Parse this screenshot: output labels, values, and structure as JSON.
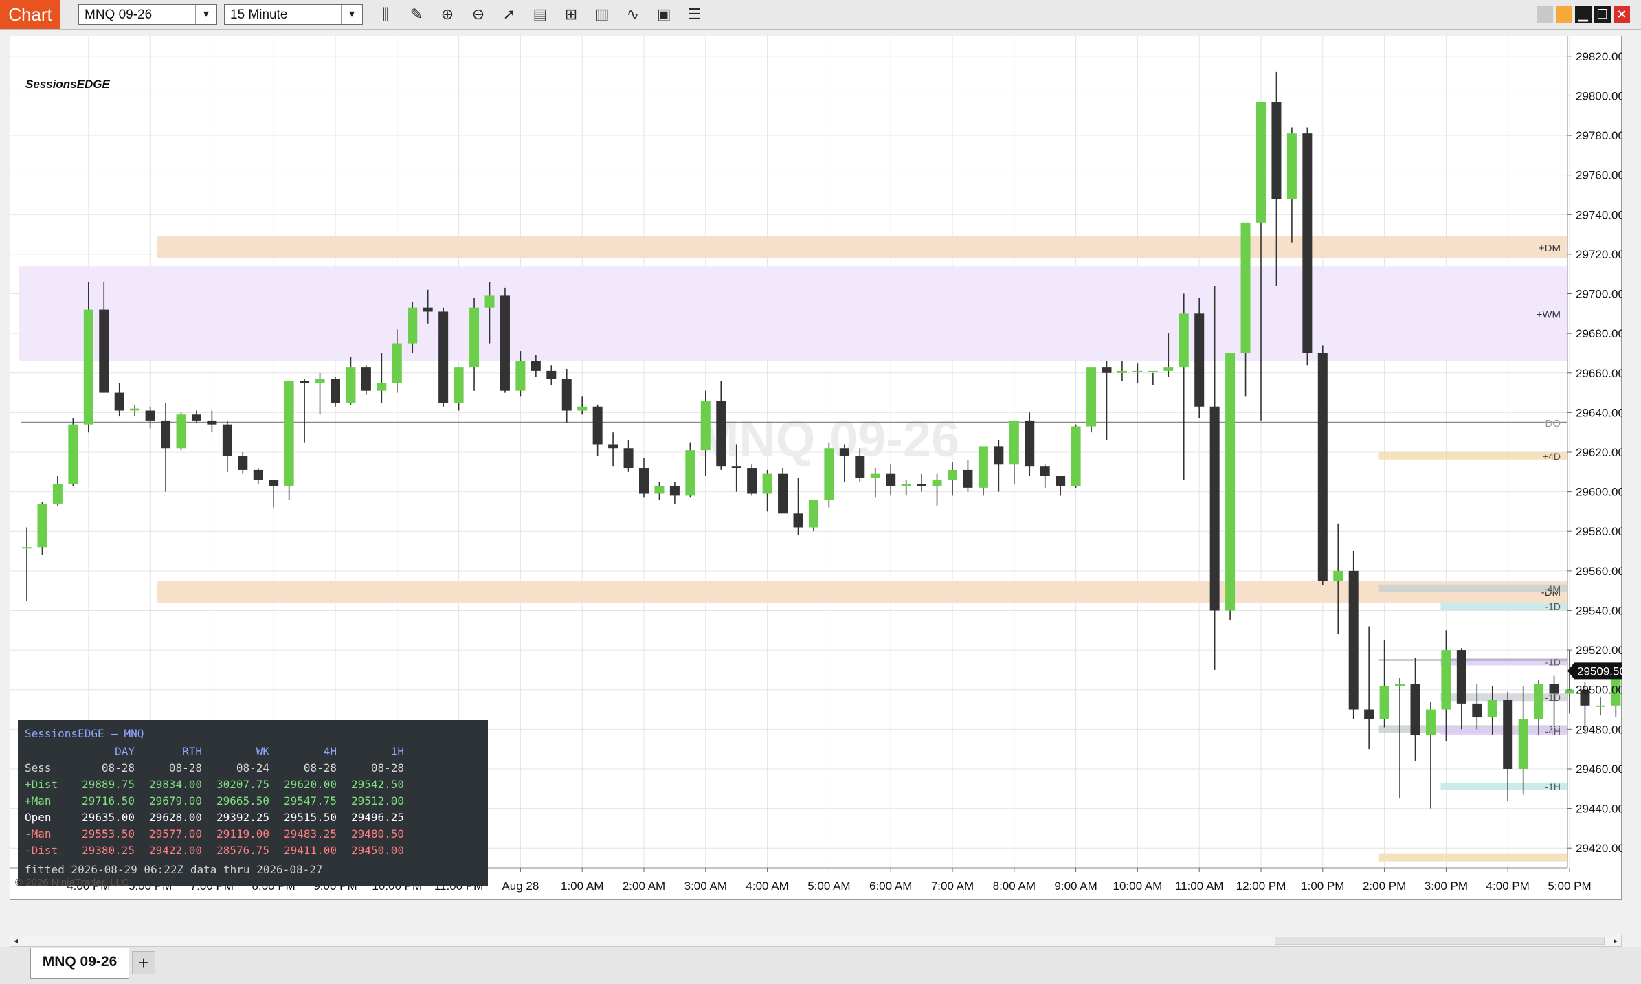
{
  "app": {
    "tab_label": "Chart",
    "instrument": "MNQ 09-26",
    "interval": "15 Minute",
    "document_tab": "MNQ 09-26",
    "add_tab_label": "+",
    "indicator_label": "SessionsEDGE",
    "watermark": "MNQ 09-26",
    "copyright": "© 2026 NinjaTrader, LLC",
    "price_marker": "29509.50"
  },
  "toolbar": {
    "tools": [
      {
        "icon": "bar-type-icon",
        "glyph": "⫼"
      },
      {
        "icon": "drawing-tool-icon",
        "glyph": "✎"
      },
      {
        "icon": "zoom-in-icon",
        "glyph": "⊕"
      },
      {
        "icon": "zoom-out-icon",
        "glyph": "⊖"
      },
      {
        "icon": "pointer-icon",
        "glyph": "➚"
      },
      {
        "icon": "data-box-icon",
        "glyph": "▤"
      },
      {
        "icon": "properties-icon",
        "glyph": "⊞"
      },
      {
        "icon": "chart-trader-icon",
        "glyph": "▥"
      },
      {
        "icon": "indicators-icon",
        "glyph": "∿"
      },
      {
        "icon": "strategies-icon",
        "glyph": "▣"
      },
      {
        "icon": "templates-icon",
        "glyph": "☰"
      }
    ],
    "window_buttons": [
      {
        "icon": "window-grey-icon",
        "color": "#c8c8c8"
      },
      {
        "icon": "window-orange-icon",
        "color": "#f4a93a"
      },
      {
        "icon": "minimize-icon",
        "color": "#1a1a1a"
      },
      {
        "icon": "maximize-icon",
        "color": "#1a1a1a"
      },
      {
        "icon": "close-icon",
        "color": "#d9302c"
      }
    ]
  },
  "colors": {
    "up_candle": "#6ccf4c",
    "down_candle": "#333333",
    "dm_zone": "#f6ddc4",
    "wm_zone": "#efe6fb",
    "day_open_line": "#888888",
    "table_bg": "#2e3338",
    "table_header": "#8fa8ff",
    "table_positive": "#7fe07f",
    "table_negative": "#ff7f7f",
    "table_open": "#ffffff"
  },
  "chart_data": {
    "type": "candlestick",
    "ylim": [
      29410,
      29830
    ],
    "y_ticks": [
      29420,
      29440,
      29460,
      29480,
      29500,
      29520,
      29540,
      29560,
      29580,
      29600,
      29620,
      29640,
      29660,
      29680,
      29700,
      29720,
      29740,
      29760,
      29780,
      29800,
      29820
    ],
    "y_tick_labels": [
      "29420.00",
      "29440.00",
      "29460.00",
      "29480.00",
      "29500.00",
      "29520.00",
      "29540.00",
      "29560.00",
      "29580.00",
      "29600.00",
      "29620.00",
      "29640.00",
      "29660.00",
      "29680.00",
      "29700.00",
      "29720.00",
      "29740.00",
      "29760.00",
      "29780.00",
      "29800.00",
      "29820.00"
    ],
    "x_labels": [
      "4:00 PM",
      "5:00 PM",
      "7:00 PM",
      "8:00 PM",
      "9:00 PM",
      "10:00 PM",
      "11:00 PM",
      "Aug 28",
      "1:00 AM",
      "2:00 AM",
      "3:00 AM",
      "4:00 AM",
      "5:00 AM",
      "6:00 AM",
      "7:00 AM",
      "8:00 AM",
      "9:00 AM",
      "10:00 AM",
      "11:00 AM",
      "12:00 PM",
      "1:00 PM",
      "2:00 PM",
      "3:00 PM",
      "4:00 PM",
      "5:00 PM"
    ],
    "x_label_bar_index": [
      4,
      8,
      12,
      16,
      20,
      24,
      28,
      32,
      36,
      40,
      44,
      48,
      52,
      56,
      60,
      64,
      68,
      72,
      76,
      80,
      84,
      88,
      92,
      96,
      100
    ],
    "candles": [
      [
        29572,
        29582,
        29545,
        29572
      ],
      [
        29572,
        29595,
        29568,
        29594
      ],
      [
        29594,
        29608,
        29593,
        29604
      ],
      [
        29604,
        29637,
        29603,
        29634
      ],
      [
        29634,
        29706,
        29630,
        29692
      ],
      [
        29692,
        29706,
        29650,
        29650
      ],
      [
        29650,
        29655,
        29638,
        29641
      ],
      [
        29641,
        29644,
        29638,
        29642
      ],
      [
        29641,
        29643,
        29632,
        29636
      ],
      [
        29636,
        29645,
        29600,
        29622
      ],
      [
        29622,
        29640,
        29621,
        29639
      ],
      [
        29639,
        29641,
        29635,
        29636
      ],
      [
        29636,
        29641,
        29630,
        29634
      ],
      [
        29634,
        29636,
        29610,
        29618
      ],
      [
        29618,
        29620,
        29609,
        29611
      ],
      [
        29611,
        29612,
        29604,
        29606
      ],
      [
        29606,
        29606,
        29592,
        29603
      ],
      [
        29603,
        29656,
        29596,
        29656
      ],
      [
        29656,
        29657,
        29625,
        29655
      ],
      [
        29655,
        29660,
        29639,
        29657
      ],
      [
        29657,
        29658,
        29643,
        29645
      ],
      [
        29645,
        29668,
        29644,
        29663
      ],
      [
        29663,
        29664,
        29649,
        29651
      ],
      [
        29651,
        29670,
        29645,
        29655
      ],
      [
        29655,
        29682,
        29650,
        29675
      ],
      [
        29675,
        29696,
        29670,
        29693
      ],
      [
        29693,
        29702,
        29685,
        29691
      ],
      [
        29691,
        29693,
        29643,
        29645
      ],
      [
        29645,
        29663,
        29641,
        29663
      ],
      [
        29663,
        29698,
        29651,
        29693
      ],
      [
        29693,
        29706,
        29675,
        29699
      ],
      [
        29699,
        29703,
        29650,
        29651
      ],
      [
        29651,
        29671,
        29648,
        29666
      ],
      [
        29666,
        29669,
        29658,
        29661
      ],
      [
        29661,
        29664,
        29654,
        29657
      ],
      [
        29657,
        29662,
        29635,
        29641
      ],
      [
        29641,
        29648,
        29639,
        29643
      ],
      [
        29643,
        29644,
        29618,
        29624
      ],
      [
        29624,
        29630,
        29613,
        29622
      ],
      [
        29622,
        29626,
        29610,
        29612
      ],
      [
        29612,
        29617,
        29597,
        29599
      ],
      [
        29599,
        29605,
        29596,
        29603
      ],
      [
        29603,
        29605,
        29594,
        29598
      ],
      [
        29598,
        29625,
        29597,
        29621
      ],
      [
        29621,
        29651,
        29608,
        29646
      ],
      [
        29646,
        29656,
        29611,
        29613
      ],
      [
        29613,
        29624,
        29600,
        29612
      ],
      [
        29612,
        29614,
        29598,
        29599
      ],
      [
        29599,
        29611,
        29590,
        29609
      ],
      [
        29609,
        29612,
        29590,
        29589
      ],
      [
        29589,
        29607,
        29578,
        29582
      ],
      [
        29582,
        29596,
        29580,
        29596
      ],
      [
        29596,
        29625,
        29592,
        29622
      ],
      [
        29622,
        29624,
        29605,
        29618
      ],
      [
        29618,
        29622,
        29605,
        29607
      ],
      [
        29607,
        29612,
        29597,
        29609
      ],
      [
        29609,
        29614,
        29598,
        29603
      ],
      [
        29603,
        29606,
        29598,
        29604
      ],
      [
        29604,
        29609,
        29600,
        29603
      ],
      [
        29603,
        29609,
        29593,
        29606
      ],
      [
        29606,
        29615,
        29598,
        29611
      ],
      [
        29611,
        29616,
        29600,
        29602
      ],
      [
        29602,
        29620,
        29598,
        29623
      ],
      [
        29623,
        29626,
        29600,
        29614
      ],
      [
        29614,
        29636,
        29604,
        29636
      ],
      [
        29636,
        29640,
        29608,
        29613
      ],
      [
        29613,
        29614,
        29602,
        29608
      ],
      [
        29608,
        29608,
        29598,
        29603
      ],
      [
        29603,
        29634,
        29602,
        29633
      ],
      [
        29633,
        29663,
        29630,
        29663
      ],
      [
        29663,
        29666,
        29626,
        29660
      ],
      [
        29660,
        29666,
        29656,
        29661
      ],
      [
        29661,
        29665,
        29655,
        29661
      ],
      [
        29661,
        29660,
        29654,
        29661
      ],
      [
        29661,
        29680,
        29658,
        29663
      ],
      [
        29663,
        29700,
        29606,
        29690
      ],
      [
        29690,
        29698,
        29637,
        29643
      ],
      [
        29643,
        29704,
        29510,
        29540
      ],
      [
        29540,
        29664,
        29535,
        29670
      ],
      [
        29670,
        29722,
        29648,
        29736
      ],
      [
        29736,
        29792,
        29636,
        29797
      ],
      [
        29797,
        29812,
        29704,
        29748
      ],
      [
        29748,
        29784,
        29726,
        29781
      ],
      [
        29781,
        29784,
        29664,
        29670
      ],
      [
        29670,
        29674,
        29553,
        29555
      ],
      [
        29555,
        29584,
        29528,
        29560
      ],
      [
        29560,
        29570,
        29485,
        29490
      ],
      [
        29490,
        29532,
        29470,
        29485
      ],
      [
        29485,
        29525,
        29481,
        29502
      ],
      [
        29502,
        29506,
        29445,
        29503
      ],
      [
        29503,
        29516,
        29464,
        29477
      ],
      [
        29477,
        29494,
        29440,
        29490
      ],
      [
        29490,
        29530,
        29474,
        29520
      ],
      [
        29520,
        29521,
        29480,
        29493
      ],
      [
        29493,
        29503,
        29480,
        29486
      ],
      [
        29486,
        29502,
        29477,
        29495
      ],
      [
        29495,
        29499,
        29444,
        29460
      ],
      [
        29460,
        29502,
        29447,
        29485
      ],
      [
        29485,
        29505,
        29477,
        29503
      ],
      [
        29503,
        29507,
        29482,
        29498
      ],
      [
        29498,
        29520,
        29488,
        29500
      ],
      [
        29500,
        29504,
        29478,
        29492
      ],
      [
        29492,
        29496,
        29487,
        29492
      ],
      [
        29492,
        29512,
        29486,
        29508
      ],
      [
        29508,
        29510,
        29496,
        29509.5
      ]
    ],
    "zones": [
      {
        "label": "+DM",
        "from": 29718,
        "to": 29729,
        "start_bar": 9,
        "color": "#f6ddc4"
      },
      {
        "label": "+WM",
        "from": 29666,
        "to": 29714,
        "start_bar": 0,
        "color": "#efe6fb"
      },
      {
        "label": "-DM",
        "from": 29544,
        "to": 29555,
        "start_bar": 9,
        "color": "#f6ddc4"
      }
    ],
    "lines": [
      {
        "label": "DO",
        "value": 29635,
        "start_bar": 0,
        "color": "#8a8a8a"
      },
      {
        "label": "",
        "value": 29515,
        "start_bar": 88,
        "color": "#9a9a9a"
      }
    ],
    "right_markers": [
      {
        "label": "+4D",
        "value": 29618,
        "start_bar": 88,
        "color": "#f2ddb3"
      },
      {
        "label": "-4M",
        "value": 29551,
        "start_bar": 88,
        "color": "#cad1d0"
      },
      {
        "label": "-1D",
        "value": 29542,
        "start_bar": 92,
        "color": "#bfe7e7"
      },
      {
        "label": "-1D",
        "value": 29514,
        "start_bar": 92,
        "color": "#dccbf5"
      },
      {
        "label": "-1D",
        "value": 29496,
        "start_bar": 92,
        "color": "#cfd2d8"
      },
      {
        "label": "-1H",
        "value": 29480,
        "start_bar": 88,
        "color": "#cad1d0"
      },
      {
        "label": "-4H",
        "value": 29479,
        "start_bar": 92,
        "color": "#dccbf5"
      },
      {
        "label": "-1H",
        "value": 29451,
        "start_bar": 92,
        "color": "#bfe7e7"
      },
      {
        "label": "",
        "value": 29415,
        "start_bar": 88,
        "color": "#f2ddb3"
      }
    ]
  },
  "table": {
    "title": "SessionsEDGE — MNQ",
    "headers": [
      "",
      "DAY",
      "RTH",
      "WK",
      "4H",
      "1H"
    ],
    "rows": [
      {
        "label": "Sess",
        "type": "sess",
        "values": [
          "08-28",
          "08-28",
          "08-24",
          "08-28",
          "08-28"
        ]
      },
      {
        "label": "+Dist",
        "type": "pos",
        "values": [
          "29889.75",
          "29834.00",
          "30207.75",
          "29620.00",
          "29542.50"
        ]
      },
      {
        "label": "+Man",
        "type": "pos",
        "values": [
          "29716.50",
          "29679.00",
          "29665.50",
          "29547.75",
          "29512.00"
        ]
      },
      {
        "label": "Open",
        "type": "open",
        "values": [
          "29635.00",
          "29628.00",
          "29392.25",
          "29515.50",
          "29496.25"
        ]
      },
      {
        "label": "-Man",
        "type": "neg",
        "values": [
          "29553.50",
          "29577.00",
          "29119.00",
          "29483.25",
          "29480.50"
        ]
      },
      {
        "label": "-Dist",
        "type": "neg",
        "values": [
          "29380.25",
          "29422.00",
          "28576.75",
          "29411.00",
          "29450.00"
        ]
      }
    ],
    "footer": "fitted 2026-08-29 06:22Z   data thru 2026-08-27"
  }
}
